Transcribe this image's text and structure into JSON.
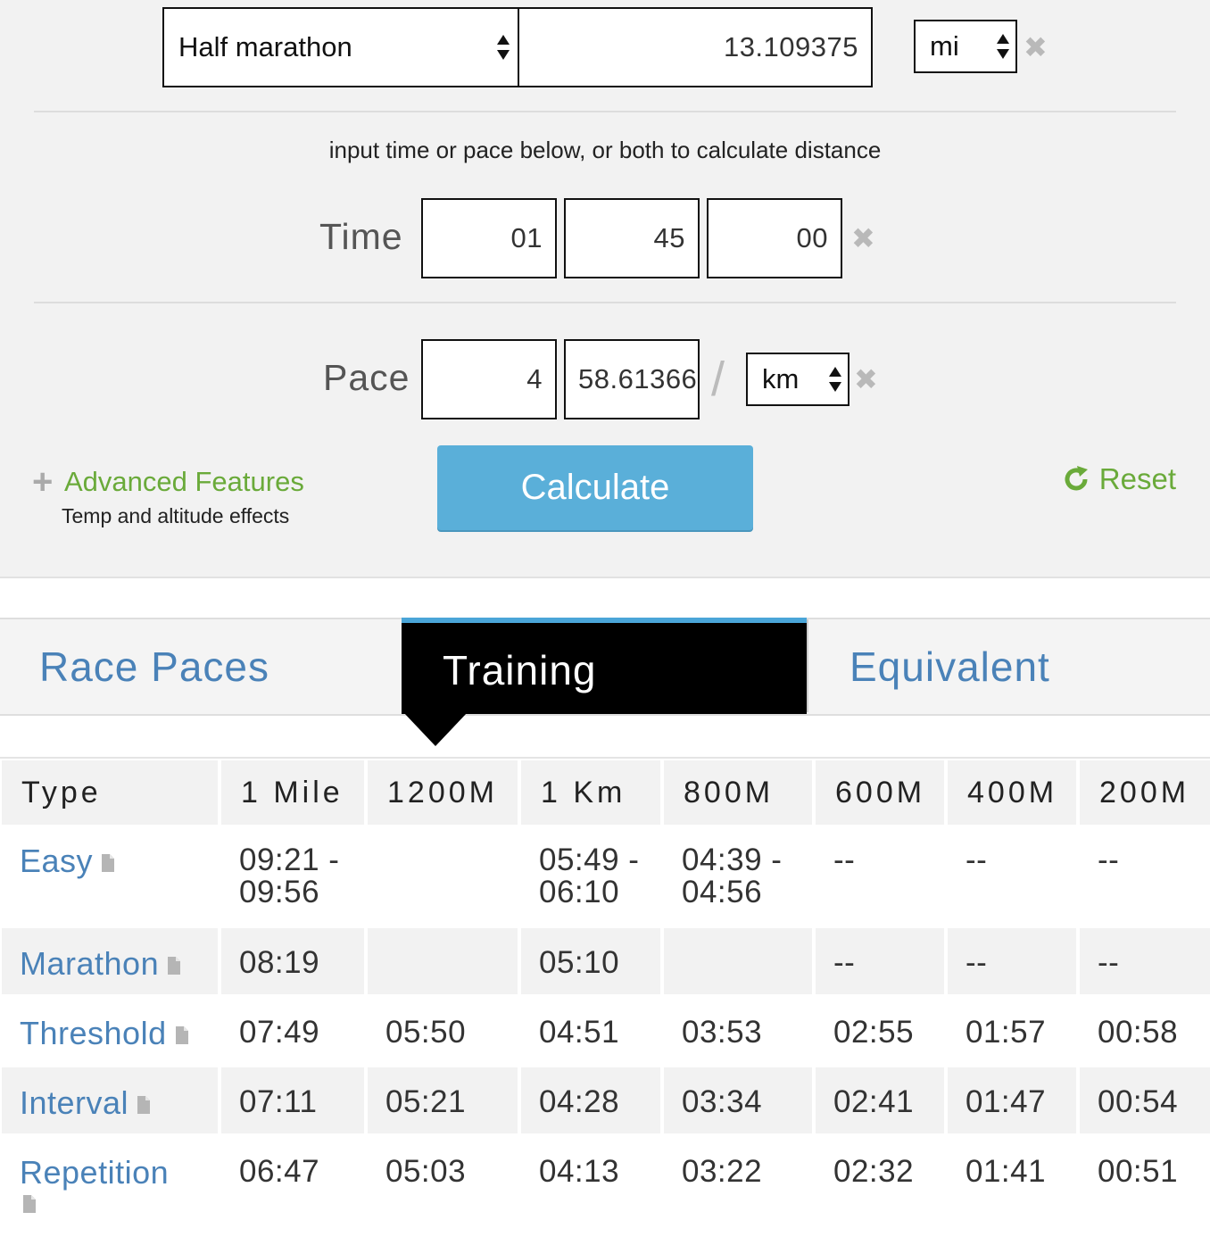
{
  "distance": {
    "race_select": "Half marathon",
    "value": "13.109375",
    "unit": "mi"
  },
  "hint": "input time or pace below, or both to calculate distance",
  "time": {
    "label": "Time",
    "hours": "01",
    "minutes": "45",
    "seconds": "00"
  },
  "pace": {
    "label": "Pace",
    "minutes": "4",
    "seconds": "58.61366",
    "separator": "/",
    "unit": "km"
  },
  "advanced": {
    "label": "Advanced Features",
    "sub": "Temp and altitude effects"
  },
  "calculate_label": "Calculate",
  "reset_label": "Reset",
  "tabs": {
    "race_paces": "Race Paces",
    "training": "Training",
    "equivalent": "Equivalent"
  },
  "table": {
    "headers": [
      "Type",
      "1 Mile",
      "1200M",
      "1 Km",
      "800M",
      "600M",
      "400M",
      "200M"
    ],
    "rows": [
      {
        "type": "Easy",
        "values": [
          "09:21 - 09:56",
          "",
          "05:49 - 06:10",
          "04:39 - 04:56",
          "--",
          "--",
          "--"
        ]
      },
      {
        "type": "Marathon",
        "values": [
          "08:19",
          "",
          "05:10",
          "",
          "--",
          "--",
          "--"
        ]
      },
      {
        "type": "Threshold",
        "values": [
          "07:49",
          "05:50",
          "04:51",
          "03:53",
          "02:55",
          "01:57",
          "00:58"
        ]
      },
      {
        "type": "Interval",
        "values": [
          "07:11",
          "05:21",
          "04:28",
          "03:34",
          "02:41",
          "01:47",
          "00:54"
        ]
      },
      {
        "type": "Repetition",
        "values": [
          "06:47",
          "05:03",
          "04:13",
          "03:22",
          "02:32",
          "01:41",
          "00:51"
        ]
      }
    ]
  },
  "colors": {
    "accent_blue": "#5aafd9",
    "link_blue": "#4a82b8",
    "green": "#6aaa3a",
    "panel_bg": "#f2f2f2"
  }
}
